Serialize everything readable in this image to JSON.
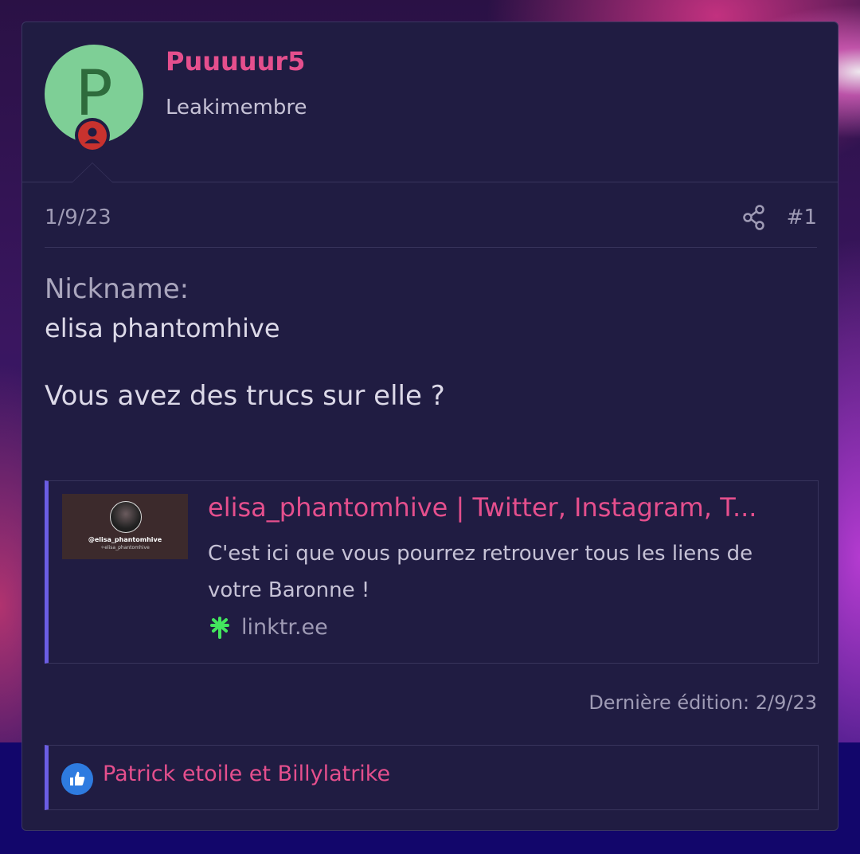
{
  "post": {
    "author": {
      "name": "Puuuuur5",
      "role": "Leakimembre",
      "avatar_letter": "P"
    },
    "date": "1/9/23",
    "post_number": "#1",
    "content": {
      "nickname_label": "Nickname:",
      "nickname_value": "elisa phantomhive",
      "question": "Vous avez des trucs sur elle ?"
    },
    "link_preview": {
      "title": "elisa_phantomhive | Twitter, Instagram, T...",
      "description": "C'est ici que vous pourrez retrouver tous les liens de votre Baronne !",
      "site": "linktr.ee",
      "thumbnail_name": "@elisa_phantomhive",
      "thumbnail_sub": "✧elisa_phantomhive"
    },
    "last_edit": "Dernière édition: 2/9/23",
    "reactions": {
      "users": "Patrick etoile et Billylatrike"
    }
  },
  "colors": {
    "accent_pink": "#e54f8d",
    "card_bg": "#201c42",
    "quote_bar": "#6b5de3",
    "avatar_bg": "#7ecf96",
    "badge_red": "#c8322e",
    "like_blue": "#2e7be0"
  },
  "icons": {
    "share": "share-icon",
    "like": "thumbs-up-icon",
    "site_logo": "linktree-logo-icon",
    "user_badge": "user-badge-icon"
  }
}
